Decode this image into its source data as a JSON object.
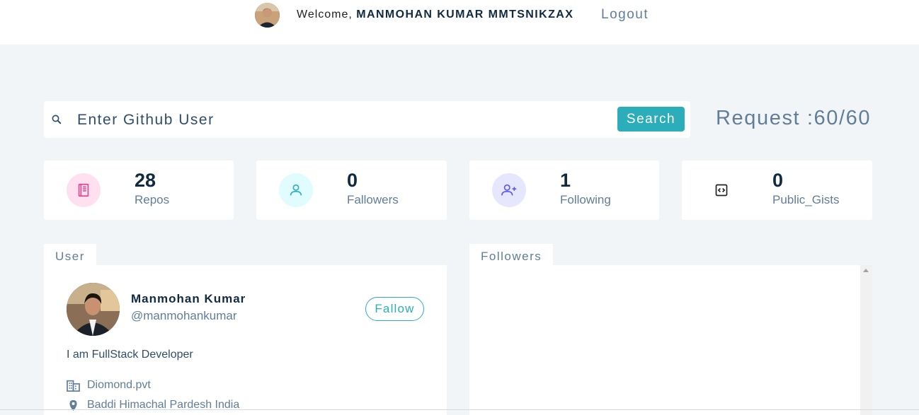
{
  "nav": {
    "welcome_prefix": "Welcome,",
    "username": "MANMOHAN KUMAR MMTSNIKZAX",
    "logout_label": "Logout"
  },
  "search": {
    "placeholder": "Enter Github User",
    "button_label": "Search",
    "request_text": "Request :60/60"
  },
  "stats": [
    {
      "value": "28",
      "label": "Repos",
      "icon": "book-icon",
      "icon_bg": "#ffe0f0",
      "icon_color": "#da4a91"
    },
    {
      "value": "0",
      "label": "Fallowers",
      "icon": "user-icon",
      "icon_bg": "#e0fcff",
      "icon_color": "#2caeba"
    },
    {
      "value": "1",
      "label": "Following",
      "icon": "user-plus-icon",
      "icon_bg": "#e6e6ff",
      "icon_color": "#5d55fa"
    },
    {
      "value": "0",
      "label": "Public_Gists",
      "icon": "code-icon",
      "icon_bg": "#ffffff",
      "icon_color": "#222222"
    }
  ],
  "user_panel": {
    "tab_label": "User",
    "name": "Manmohan Kumar",
    "handle": "@manmohankumar",
    "follow_label": "Fallow",
    "bio": "I am FullStack Developer",
    "company": "Diomond.pvt",
    "location": "Baddi Himachal Pardesh India"
  },
  "followers_panel": {
    "tab_label": "Followers"
  },
  "colors": {
    "accent": "#2caeba",
    "background": "#f1f5f8",
    "heading": "#102a42",
    "muted": "#617d98"
  }
}
